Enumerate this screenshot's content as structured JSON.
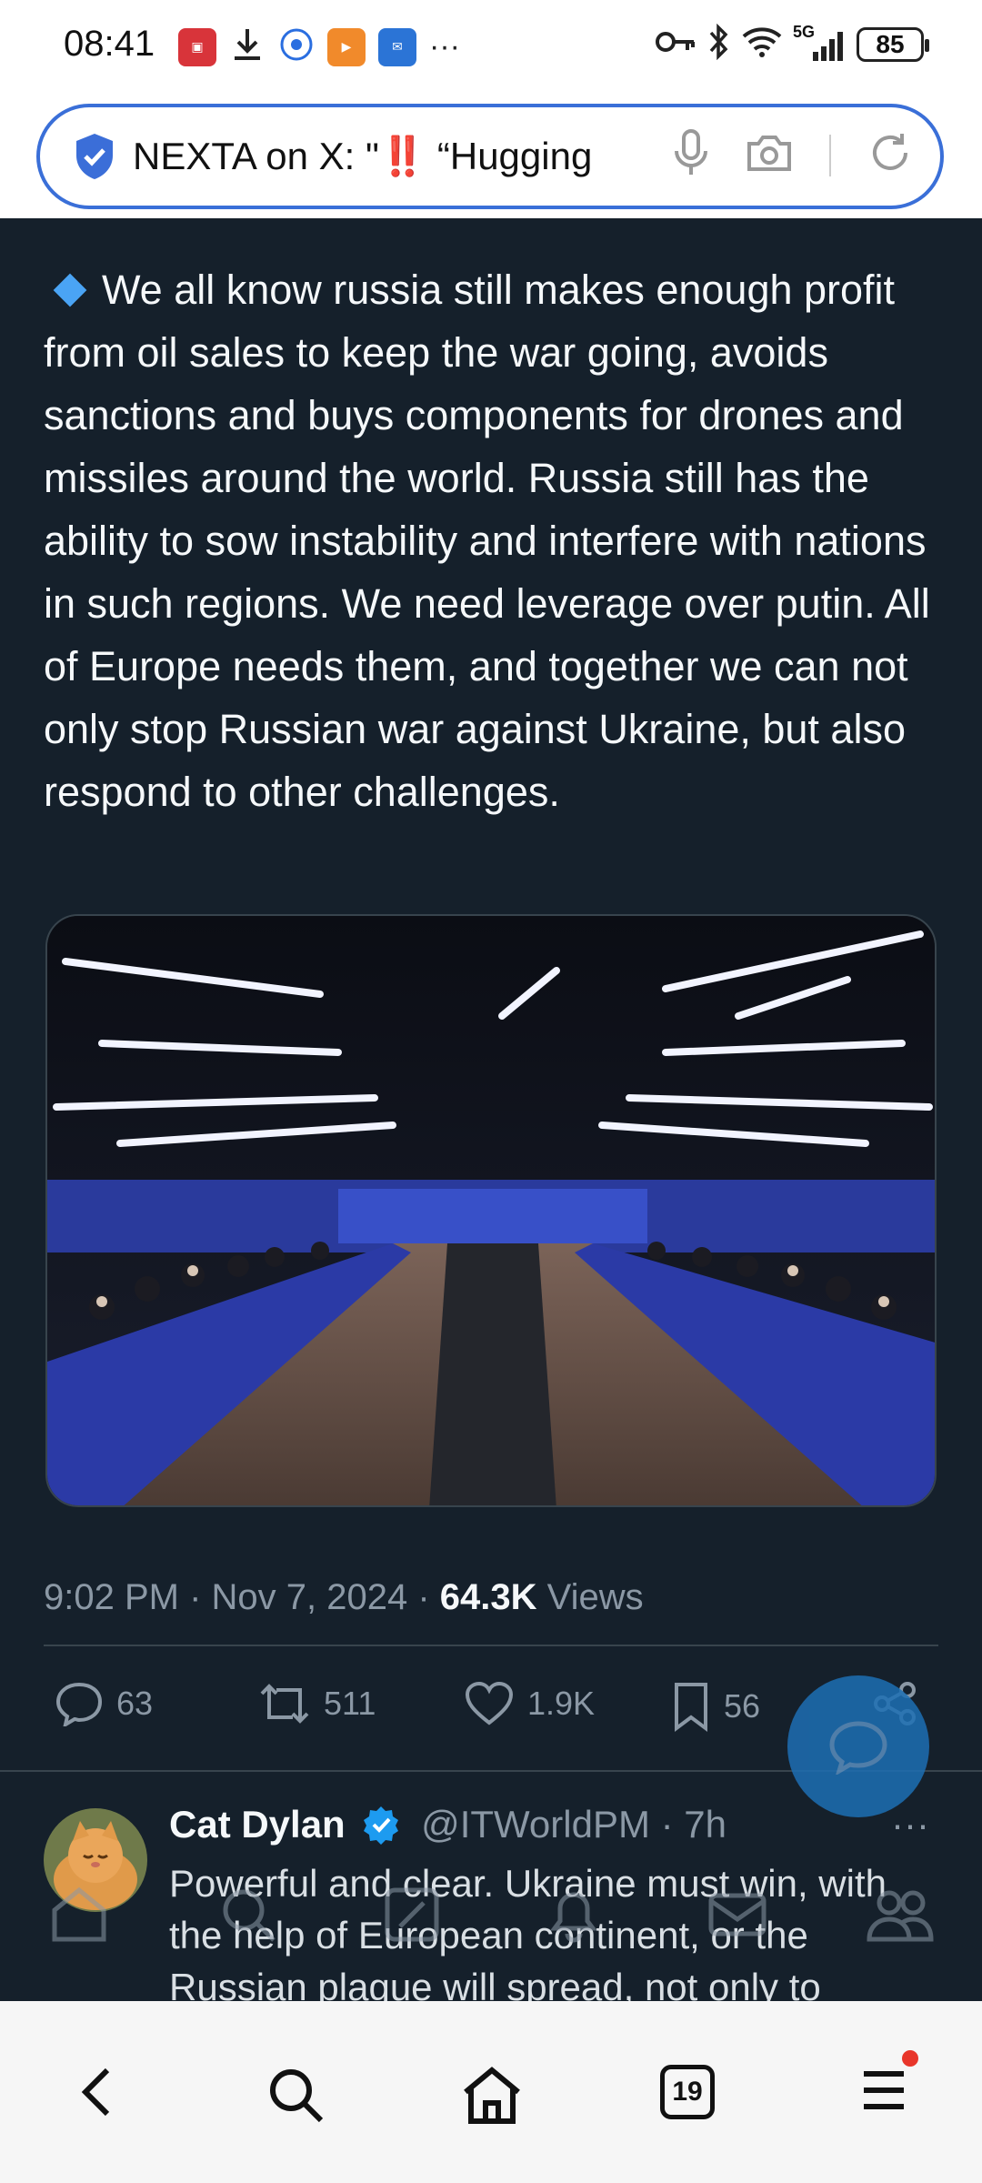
{
  "status_bar": {
    "time": "08:41",
    "overflow": "···",
    "network": "5G",
    "battery": "85",
    "app_icons": [
      "app-red-icon",
      "download-icon",
      "ifly-icon",
      "play-icon",
      "mail-icon"
    ]
  },
  "browser": {
    "url_text": "NEXTA on X: \"‼️ “Hugging",
    "tab_count": "19",
    "accent": "#3a6fd8"
  },
  "tweet": {
    "body": "We all know russia still makes enough profit from oil sales to keep the war going, avoids sanctions and buys components for drones and missiles around the world. Russia still has the ability to sow instability and interfere with nations in such regions. We need leverage over putin. All of Europe needs them, and together we can not only stop Russian war against Ukraine, but also respond to other challenges.",
    "timestamp": "9:02 PM · Nov 7, 2024 · ",
    "views_count": "64.3K",
    "views_label": " Views",
    "actions": {
      "replies": "63",
      "reposts": "511",
      "likes": "1.9K",
      "bookmarks": "56"
    }
  },
  "reply": {
    "name": "Cat Dylan",
    "handle": "@ITWorldPM · 7h",
    "more": "···",
    "text": "Powerful and clear.  Ukraine must win, with the help of European continent, or the Russian plague will spread, not only to"
  },
  "colors": {
    "background": "#15202b",
    "text": "#f5f8fa",
    "muted": "#8b98a5",
    "verified": "#1d9bf0",
    "diamond": "#4aa4f5"
  }
}
